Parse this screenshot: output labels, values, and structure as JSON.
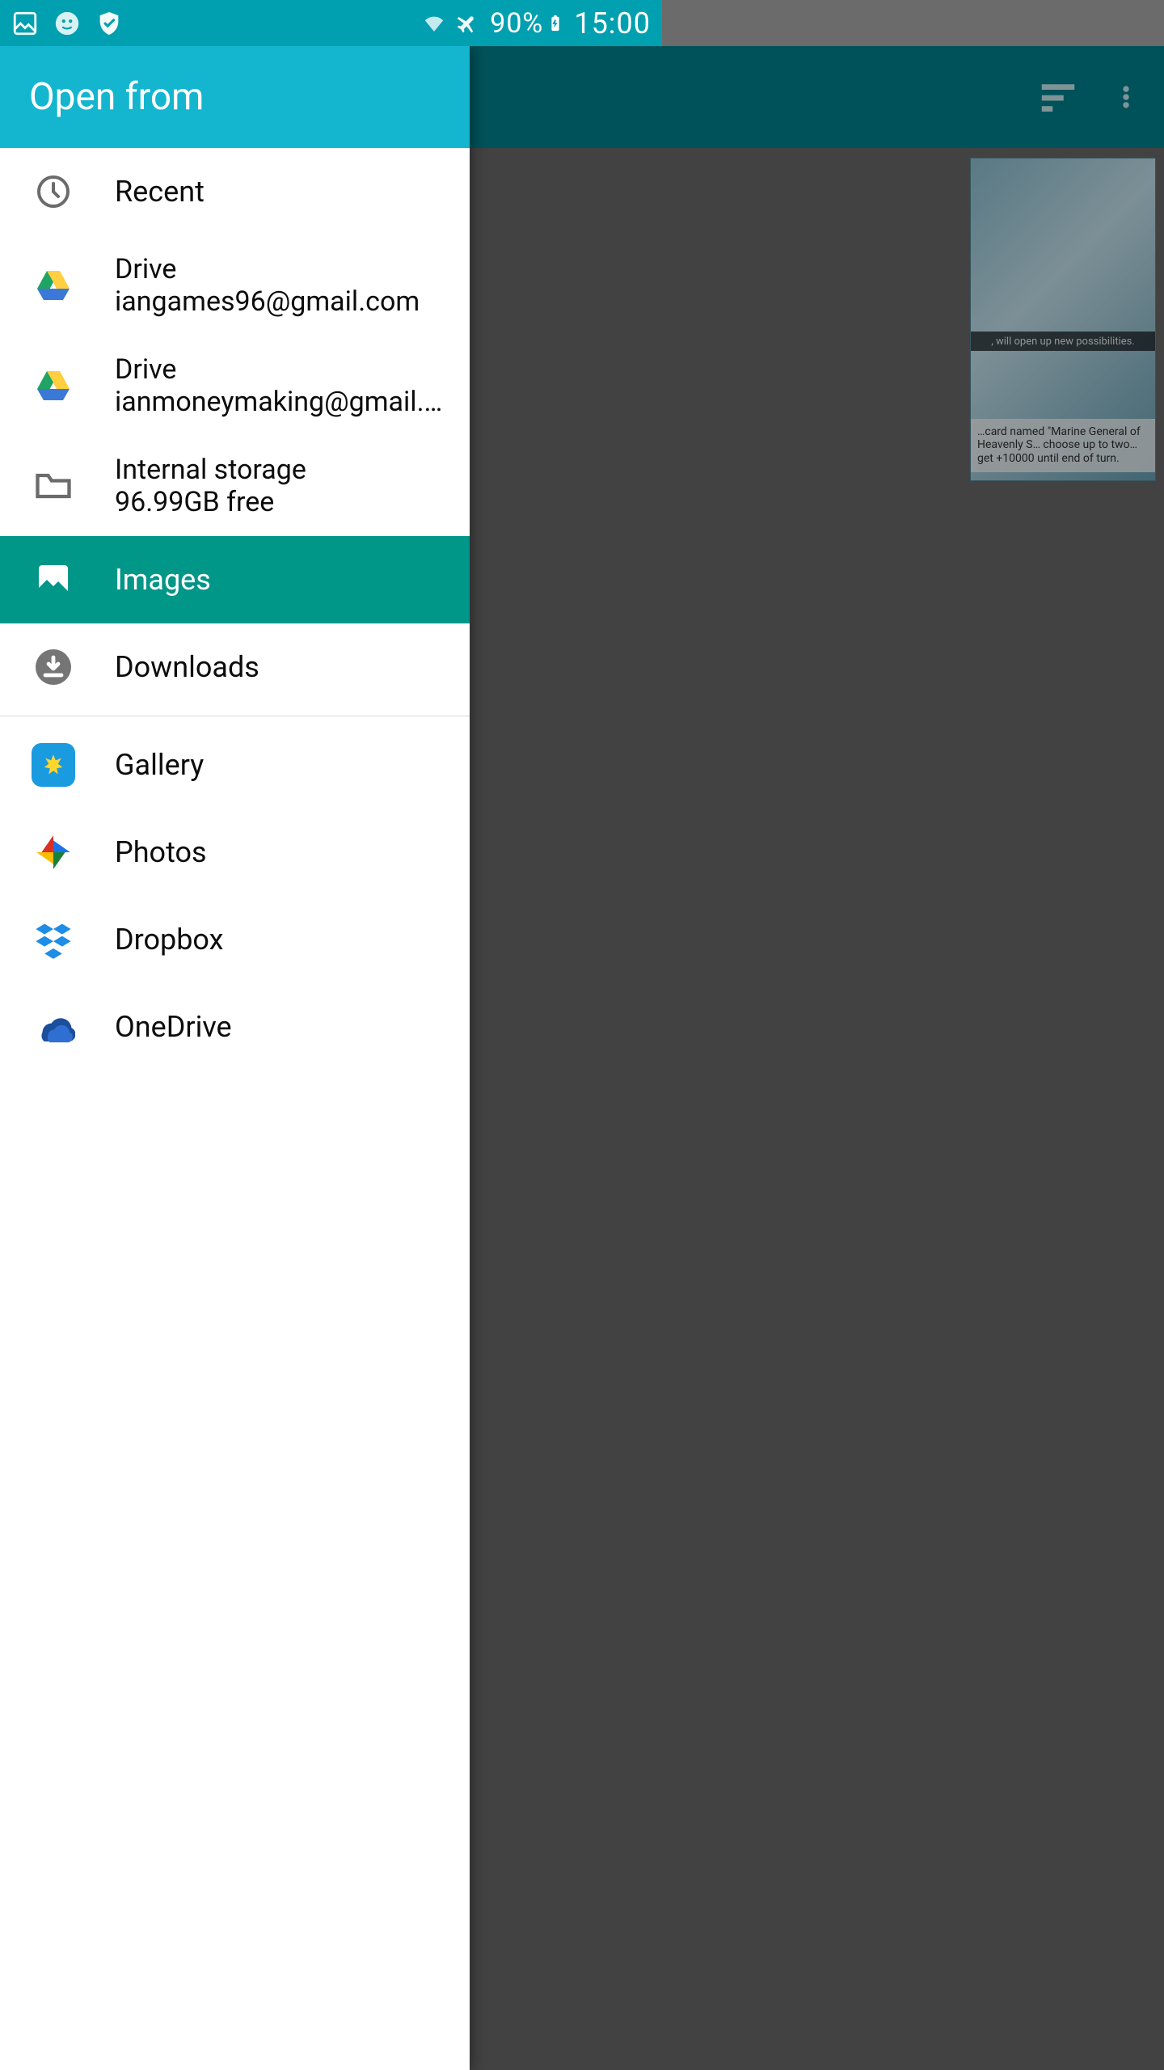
{
  "status": {
    "battery": "90%",
    "time": "15:00"
  },
  "drawer": {
    "title": "Open from",
    "sources": [
      {
        "id": "recent",
        "label": "Recent",
        "subtitle": null
      },
      {
        "id": "drive1",
        "label": "Drive",
        "subtitle": "iangames96@gmail.com"
      },
      {
        "id": "drive2",
        "label": "Drive",
        "subtitle": "ianmoneymaking@gmail.…"
      },
      {
        "id": "internal",
        "label": "Internal storage",
        "subtitle": "96.99GB free"
      },
      {
        "id": "images",
        "label": "Images",
        "subtitle": null,
        "selected": true
      },
      {
        "id": "downloads",
        "label": "Downloads",
        "subtitle": null
      }
    ],
    "apps": [
      {
        "id": "gallery",
        "label": "Gallery"
      },
      {
        "id": "photos",
        "label": "Photos"
      },
      {
        "id": "dropbox",
        "label": "Dropbox"
      },
      {
        "id": "onedrive",
        "label": "OneDrive"
      }
    ]
  }
}
